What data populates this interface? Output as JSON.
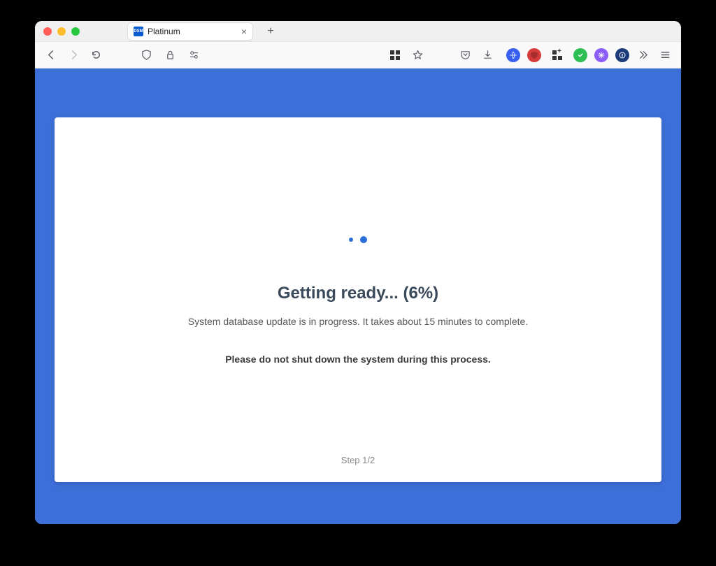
{
  "browser": {
    "tab_title": "Platinum",
    "favicon_text": "DSM"
  },
  "page": {
    "heading": "Getting ready... (6%)",
    "subtext": "System database update is in progress. It takes about 15 minutes to complete.",
    "warning": "Please do not shut down the system during this process.",
    "step": "Step 1/2"
  }
}
